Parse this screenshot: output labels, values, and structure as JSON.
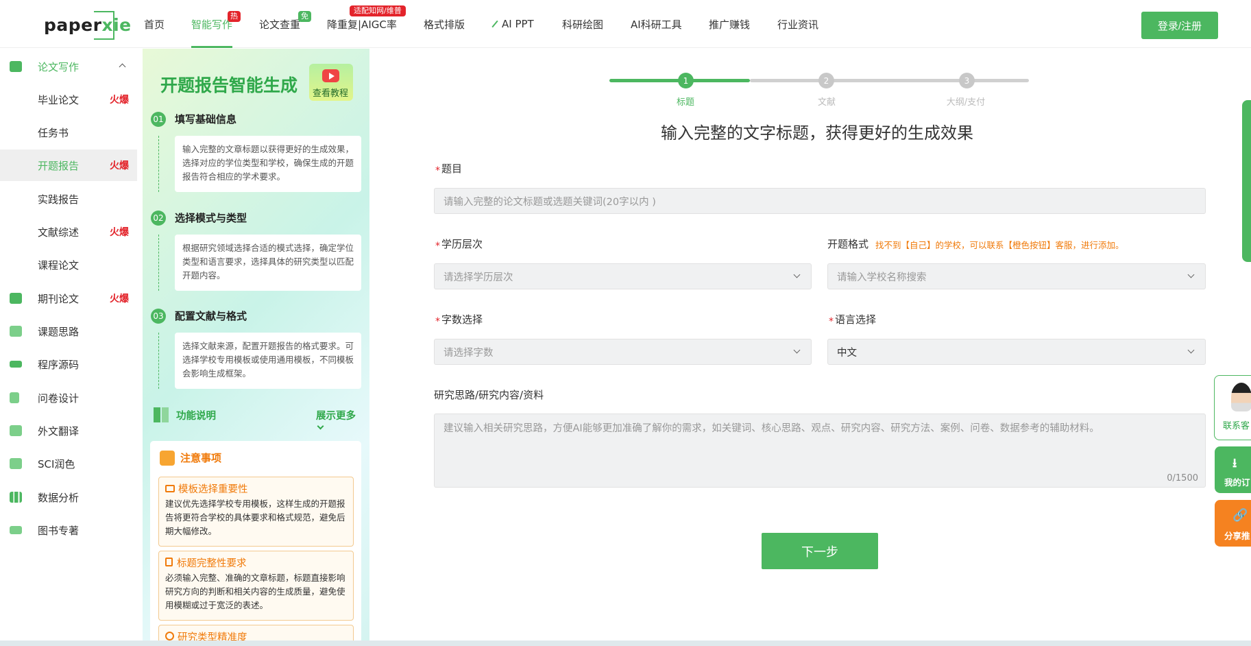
{
  "header": {
    "logo_pre": "paper",
    "logo_post": "xie",
    "nav": [
      {
        "label": "首页"
      },
      {
        "label": "智能写作",
        "tag": "热"
      },
      {
        "label": "论文查重",
        "tag": "免"
      },
      {
        "label": "降重复|AIGC率",
        "tag": "适配知网/维普"
      },
      {
        "label": "格式排版"
      },
      {
        "label": "AI PPT"
      },
      {
        "label": "科研绘图"
      },
      {
        "label": "AI科研工具"
      },
      {
        "label": "推广赚钱"
      },
      {
        "label": "行业资讯"
      }
    ],
    "login": "登录/注册"
  },
  "sidebar": {
    "section": "论文写作",
    "items": [
      {
        "label": "毕业论文",
        "hot": "火爆"
      },
      {
        "label": "任务书"
      },
      {
        "label": "开题报告",
        "hot": "火爆"
      },
      {
        "label": "实践报告"
      },
      {
        "label": "文献综述",
        "hot": "火爆"
      },
      {
        "label": "课程论文"
      },
      {
        "label": "期刊论文",
        "hot": "火爆"
      },
      {
        "label": "课题思路"
      },
      {
        "label": "程序源码"
      },
      {
        "label": "问卷设计"
      },
      {
        "label": "外文翻译"
      },
      {
        "label": "SCI润色"
      },
      {
        "label": "数据分析"
      },
      {
        "label": "图书专著"
      }
    ]
  },
  "guide": {
    "title": "开题报告智能生成",
    "tutorial": "查看教程",
    "steps": [
      {
        "num": "01",
        "title": "填写基础信息",
        "desc": "输入完整的文章标题以获得更好的生成效果，选择对应的学位类型和学校，确保生成的开题报告符合相应的学术要求。"
      },
      {
        "num": "02",
        "title": "选择模式与类型",
        "desc": "根据研究领域选择合适的模式选择，确定学位类型和语言要求，选择具体的研究类型以匹配开题内容。"
      },
      {
        "num": "03",
        "title": "配置文献与格式",
        "desc": "选择文献来源，配置开题报告的格式要求。可选择学校专用模板或使用通用模板，不同模板会影响生成框架。"
      }
    ],
    "func_title": "功能说明",
    "func_more": "展示更多",
    "notice_title": "注意事项",
    "notices": [
      {
        "title": "模板选择重要性",
        "desc": "建议优先选择学校专用模板，这样生成的开题报告将更符合学校的具体要求和格式规范，避免后期大幅修改。"
      },
      {
        "title": "标题完整性要求",
        "desc": "必须输入完整、准确的文章标题，标题直接影响研究方向的判断和相关内容的生成质量，避免使用模糊或过于宽泛的表述。"
      },
      {
        "title": "研究类型精准度",
        "desc": ""
      }
    ]
  },
  "stepper": {
    "steps": [
      {
        "num": "1",
        "label": "标题"
      },
      {
        "num": "2",
        "label": "文献"
      },
      {
        "num": "3",
        "label": "大纲/支付"
      }
    ],
    "colors": {
      "active": "#4cb760",
      "inactive": "#cccccc"
    }
  },
  "form": {
    "heading": "输入完整的文字标题，获得更好的生成效果",
    "topic": {
      "label": "题目",
      "placeholder": "请输入完整的论文标题或选题关键词(20字以内 )"
    },
    "degree": {
      "label": "学历层次",
      "placeholder": "请选择学历层次"
    },
    "format": {
      "label": "开题格式",
      "hint": "找不到【自己】的学校，可以联系【橙色按钮】客服，进行添加。",
      "placeholder": "请输入学校名称搜索"
    },
    "words": {
      "label": "字数选择",
      "placeholder": "请选择字数"
    },
    "lang": {
      "label": "语言选择",
      "value": "中文"
    },
    "research": {
      "label": "研究思路/研究内容/资料",
      "placeholder": "建议输入相关研究思路，方便AI能够更加准确了解你的需求，如关键词、核心思路、观点、研究内容、研究方法、案例、问卷、数据参考的辅助材料。",
      "count": "0/1500"
    },
    "next": "下一步"
  },
  "floating": {
    "service": "联系客",
    "orders": "我的订",
    "share": "分享推"
  },
  "colors": {
    "brand": "#4cb760",
    "hot": "#e3242b",
    "accent": "#f07a0a"
  }
}
